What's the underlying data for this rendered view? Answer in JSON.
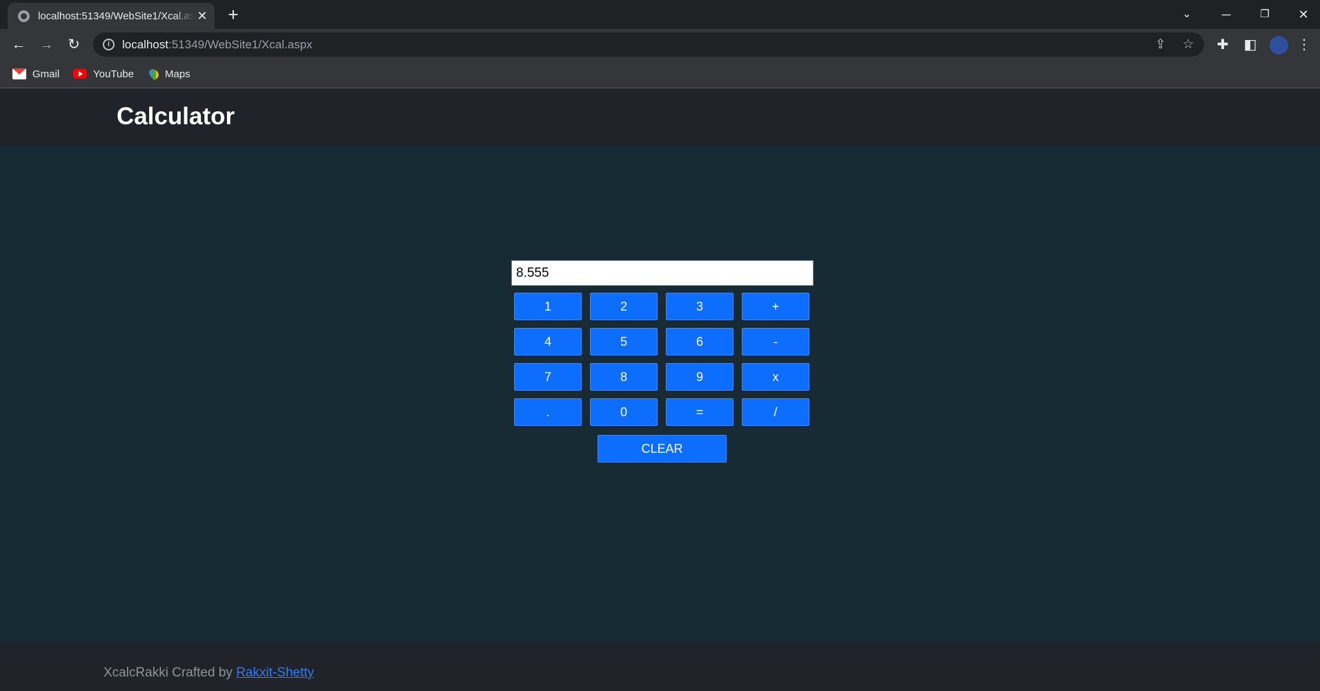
{
  "browser": {
    "tab_title": "localhost:51349/WebSite1/Xcal.aspx",
    "url_host": "localhost",
    "url_rest": ":51349/WebSite1/Xcal.aspx",
    "bookmarks": [
      "Gmail",
      "YouTube",
      "Maps"
    ]
  },
  "page": {
    "title": "Calculator",
    "display_value": "8.555",
    "buttons": [
      "1",
      "2",
      "3",
      "+",
      "4",
      "5",
      "6",
      "-",
      "7",
      "8",
      "9",
      "x",
      ".",
      "0",
      "=",
      "/"
    ],
    "clear_label": "CLEAR",
    "footer_text": "XcalcRakki Crafted by ",
    "footer_link": "Rakxit-Shetty"
  },
  "colors": {
    "button": "#0d6efd",
    "page_bg": "#172b35",
    "header_bg": "#202329"
  }
}
